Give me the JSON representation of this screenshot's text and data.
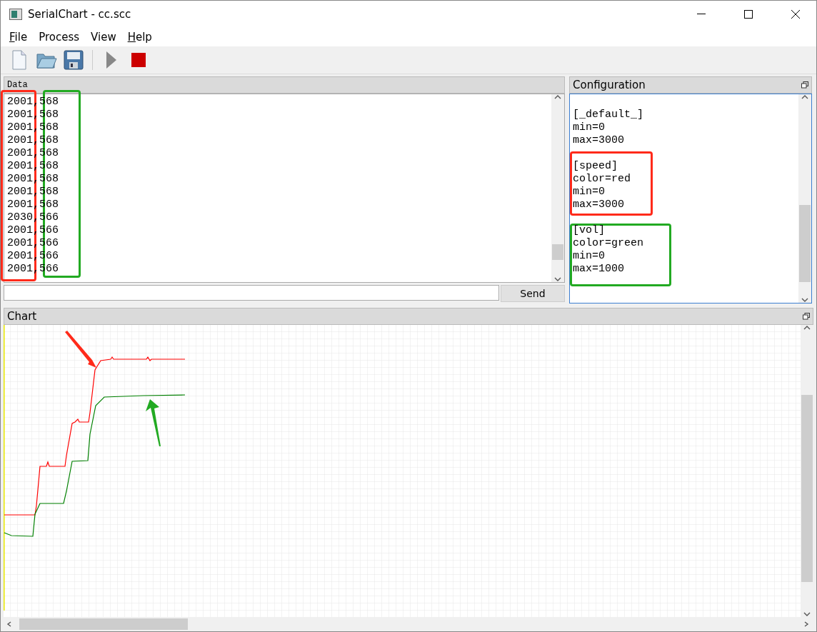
{
  "window": {
    "title": "SerialChart - cc.scc"
  },
  "menu": [
    {
      "label": "File",
      "mnemonic": true
    },
    {
      "label": "Process",
      "mnemonic": false
    },
    {
      "label": "View",
      "mnemonic": false
    },
    {
      "label": "Help",
      "mnemonic": true
    }
  ],
  "toolbar": [
    {
      "kind": "new"
    },
    {
      "kind": "open"
    },
    {
      "kind": "save"
    },
    {
      "kind": "run",
      "disabled": true
    },
    {
      "kind": "stop",
      "disabled": false
    }
  ],
  "data_panel": {
    "title": "Data",
    "rows": [
      "2001,568",
      "2001,568",
      "2001,568",
      "2001,568",
      "2001,568",
      "2001,568",
      "2001,568",
      "2001,568",
      "2001,568",
      "2030,566",
      "2001,566",
      "2001,566",
      "2001,566",
      "2001,566"
    ],
    "send_button": "Send"
  },
  "config_panel": {
    "title": "Configuration",
    "sections": [
      {
        "lines": [
          "[_default_]",
          "min=0",
          "max=3000"
        ]
      },
      {
        "lines": [
          "[speed]",
          "color=red",
          "min=0",
          "max=3000"
        ]
      },
      {
        "lines": [
          "[vol]",
          "color=green",
          "min=0",
          "max=1000"
        ]
      }
    ]
  },
  "chart_panel": {
    "title": "Chart"
  }
}
